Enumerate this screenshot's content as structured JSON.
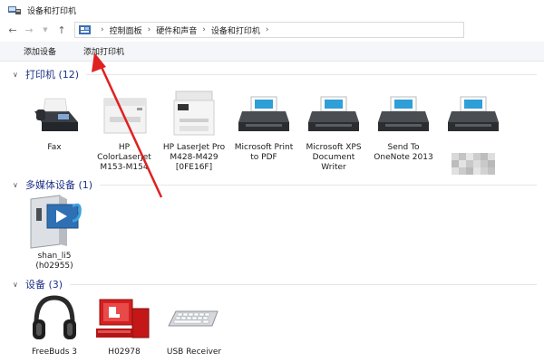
{
  "window": {
    "title": "设备和打印机"
  },
  "nav": {
    "breadcrumbs": [
      "控制面板",
      "硬件和声音",
      "设备和打印机"
    ]
  },
  "commands": {
    "add_device": "添加设备",
    "add_printer": "添加打印机"
  },
  "groups": {
    "printers": {
      "title": "打印机 (12)",
      "items": [
        {
          "label": "Fax",
          "icon": "fax-icon"
        },
        {
          "label": "HP\nColorLaserJet\nM153-M154",
          "icon": "laser-printer-icon"
        },
        {
          "label": "HP LaserJet Pro\nM428-M429\n[0FE16F]",
          "icon": "mfp-printer-icon"
        },
        {
          "label": "Microsoft Print\nto PDF",
          "icon": "printer-icon"
        },
        {
          "label": "Microsoft XPS\nDocument\nWriter",
          "icon": "printer-icon"
        },
        {
          "label": "Send To\nOneNote 2013",
          "icon": "printer-icon"
        }
      ]
    },
    "multimedia": {
      "title": "多媒体设备 (1)",
      "items": [
        {
          "label": "shan_li5\n(h02955)",
          "icon": "media-server-icon"
        }
      ]
    },
    "devices": {
      "title": "设备 (3)",
      "items": [
        {
          "label": "FreeBuds 3",
          "icon": "headphones-icon"
        },
        {
          "label": "H02978",
          "icon": "computer-icon"
        },
        {
          "label": "USB Receiver",
          "icon": "keyboard-icon"
        }
      ]
    }
  },
  "colors": {
    "group_title": "#1e3287",
    "arrow": "#e02020",
    "command_bar": "#f4f6f9"
  }
}
